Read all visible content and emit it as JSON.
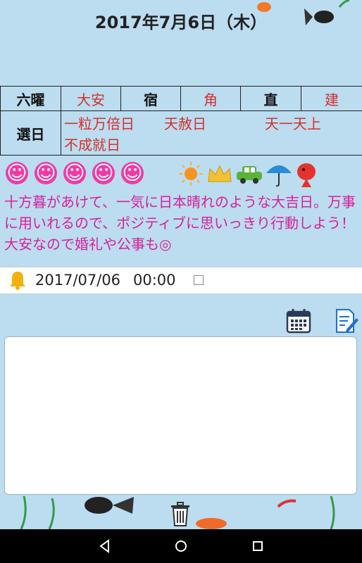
{
  "header": {
    "date_title": "2017年7月6日（木）"
  },
  "almanac": {
    "rokuyo_label": "六曜",
    "rokuyo_value": "大安",
    "shuku_label": "宿",
    "shuku_value": "角",
    "choku_label": "直",
    "choku_value": "建",
    "senjitsu_label": "選日",
    "senjitsu_items": [
      "一粒万倍日",
      "天赦日",
      "天一天上",
      "不成就日"
    ]
  },
  "fortune": {
    "smile_count": 5,
    "message": "十方暮があけて、一気に日本晴れのような大吉日。万事に用いれるので、ポジティブに思いっきり行動しよう！大安なので婚礼や公事も◎"
  },
  "alarm": {
    "date": "2017/07/06",
    "time": "00:00"
  },
  "memo": {
    "value": ""
  },
  "colors": {
    "background": "#bcdcf0",
    "rokuyo_red": "#d2322a",
    "message_pink": "#d6219b",
    "smile_pink": "#f03aa8",
    "icon_navy": "#2b3a55",
    "icon_blue": "#1f6fd0"
  },
  "icons": {
    "alarm": "bell-icon",
    "calendar": "calendar-icon",
    "edit": "edit-note-icon",
    "delete": "trash-icon"
  }
}
